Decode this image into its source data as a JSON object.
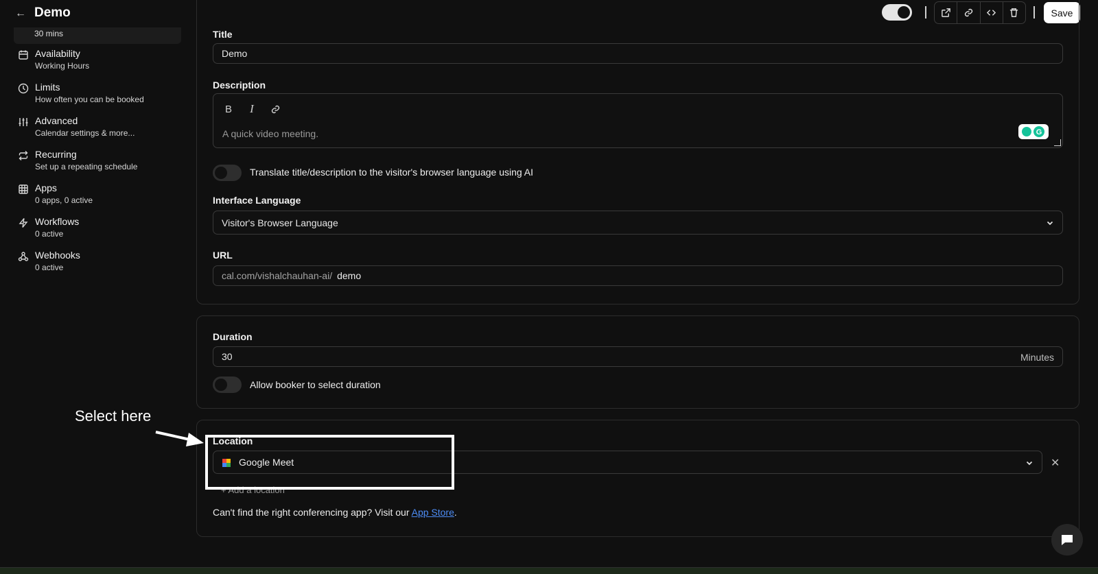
{
  "header": {
    "title": "Demo",
    "save_label": "Save"
  },
  "sidebar": {
    "active_sub": "30 mins",
    "items": [
      {
        "title": "Availability",
        "sub": "Working Hours",
        "icon": "calendar-icon"
      },
      {
        "title": "Limits",
        "sub": "How often you can be booked",
        "icon": "clock-icon"
      },
      {
        "title": "Advanced",
        "sub": "Calendar settings & more...",
        "icon": "sliders-icon"
      },
      {
        "title": "Recurring",
        "sub": "Set up a repeating schedule",
        "icon": "repeat-icon"
      },
      {
        "title": "Apps",
        "sub": "0 apps, 0 active",
        "icon": "grid-icon"
      },
      {
        "title": "Workflows",
        "sub": "0 active",
        "icon": "zap-icon"
      },
      {
        "title": "Webhooks",
        "sub": "0 active",
        "icon": "webhook-icon"
      }
    ]
  },
  "details": {
    "title_label": "Title",
    "title_value": "Demo",
    "description_label": "Description",
    "description_placeholder": "A quick video meeting.",
    "translate_label": "Translate title/description to the visitor's browser language using AI",
    "interface_language_label": "Interface Language",
    "interface_language_value": "Visitor's Browser Language",
    "url_label": "URL",
    "url_prefix": "cal.com/vishalchauhan-ai/",
    "url_slug": "demo"
  },
  "duration": {
    "label": "Duration",
    "value": "30",
    "unit": "Minutes",
    "allow_select_label": "Allow booker to select duration"
  },
  "location": {
    "label": "Location",
    "value": "Google Meet",
    "add_label": "Add a location",
    "help_text": "Can't find the right conferencing app? Visit our",
    "help_link": "App Store",
    "help_end": "."
  },
  "annotation": {
    "text": "Select here"
  }
}
